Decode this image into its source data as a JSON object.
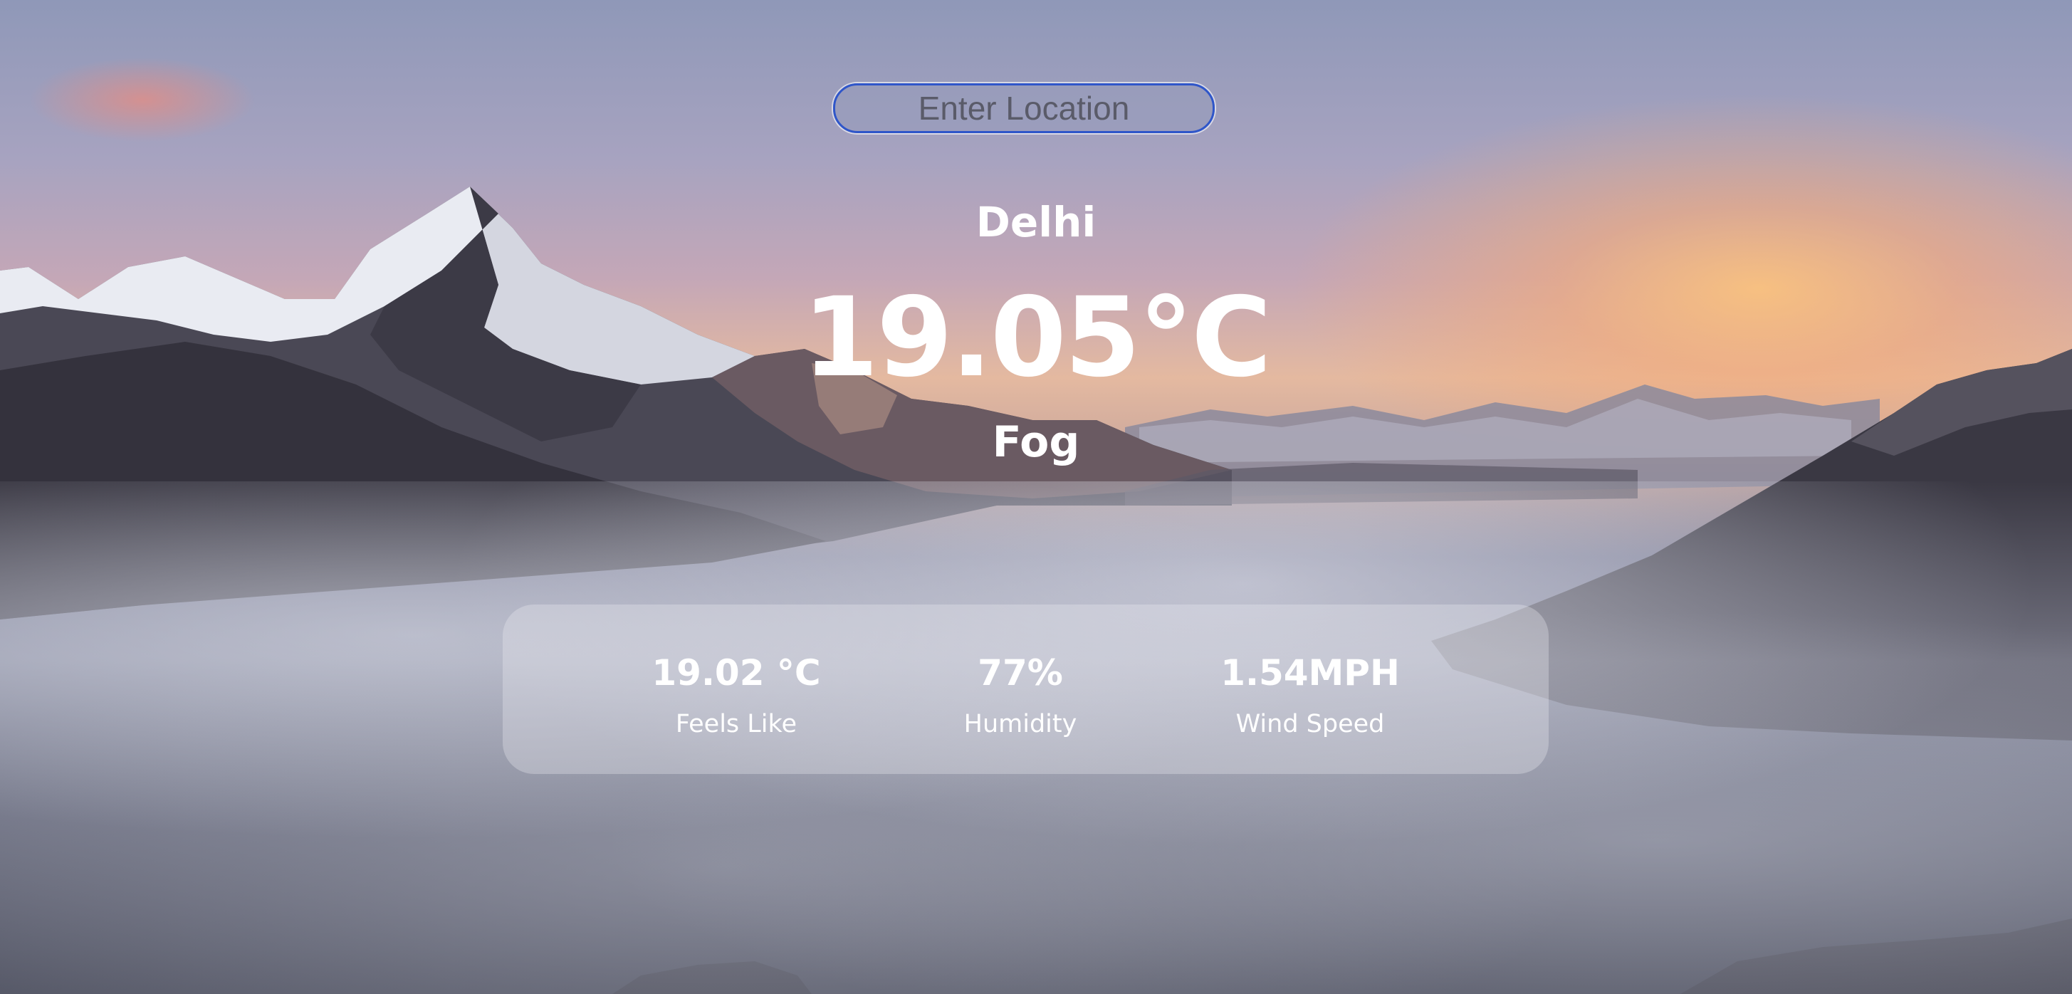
{
  "search": {
    "placeholder": "Enter Location"
  },
  "weather": {
    "city": "Delhi",
    "temperature": "19.05°C",
    "condition": "Fog"
  },
  "details": {
    "feels_like": {
      "value": "19.02 °C",
      "label": "Feels Like"
    },
    "humidity": {
      "value": "77%",
      "label": "Humidity"
    },
    "wind_speed": {
      "value": "1.54MPH",
      "label": "Wind Speed"
    }
  },
  "colors": {
    "input_border": "#2f56c9",
    "text": "#ffffff"
  }
}
